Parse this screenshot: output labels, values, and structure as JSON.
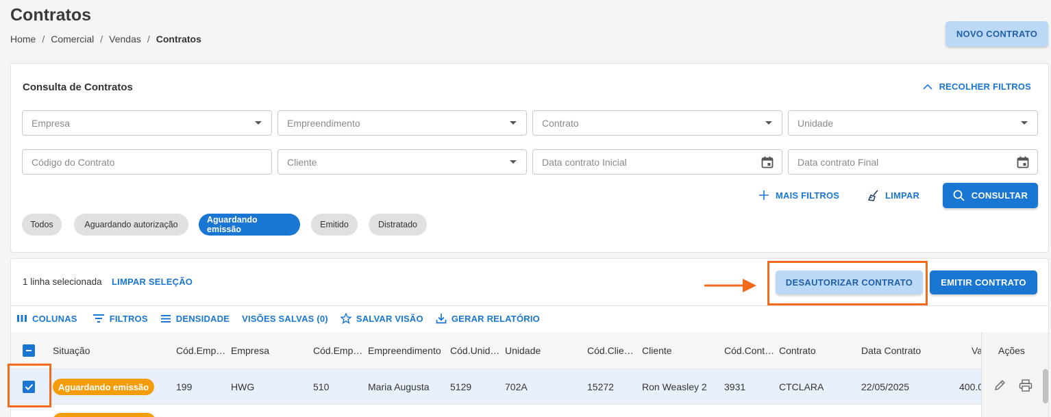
{
  "page": {
    "title": "Contratos"
  },
  "breadcrumb": {
    "items": [
      "Home",
      "Comercial",
      "Vendas"
    ],
    "current": "Contratos",
    "separator": "/"
  },
  "header": {
    "new_button": "NOVO CONTRATO"
  },
  "filters": {
    "title": "Consulta de Contratos",
    "collapse_label": "RECOLHER FILTROS",
    "fields": {
      "empresa": "Empresa",
      "empreendimento": "Empreendimento",
      "contrato": "Contrato",
      "unidade": "Unidade",
      "codigo": "Código do Contrato",
      "cliente": "Cliente",
      "data_inicial": "Data contrato Inicial",
      "data_final": "Data contrato Final"
    },
    "more_filters": "MAIS FILTROS",
    "clear": "LIMPAR",
    "search": "CONSULTAR",
    "chips": [
      "Todos",
      "Aguardando autorização",
      "Aguardando emissão",
      "Emitido",
      "Distratado"
    ],
    "active_chip": "Aguardando emissão"
  },
  "selection": {
    "text": "1 linha selecionada",
    "clear": "LIMPAR SELEÇÃO",
    "deauthorize": "DESAUTORIZAR CONTRATO",
    "emit": "EMITIR CONTRATO"
  },
  "toolbar": {
    "columns": "COLUNAS",
    "filters": "FILTROS",
    "density": "DENSIDADE",
    "saved_views": "VISÕES SALVAS (0)",
    "save_view": "SALVAR VISÃO",
    "report": "GERAR RELATÓRIO"
  },
  "table": {
    "headers": [
      "Situação",
      "Cód.Emp…",
      "Empresa",
      "Cód.Emp…",
      "Empreendimento",
      "Cód.Unid…",
      "Unidade",
      "Cód.Clie…",
      "Cliente",
      "Cód.Cont…",
      "Contrato",
      "Data Contrato",
      "Va",
      "Ações"
    ],
    "rows": [
      {
        "status": "Aguardando emissão",
        "cod_empresa": "199",
        "empresa": "HWG",
        "cod_empreend": "510",
        "empreendimento": "Maria Augusta",
        "cod_unidade": "5129",
        "unidade": "702A",
        "cod_cliente": "15272",
        "cliente": "Ron Weasley 2",
        "cod_contrato": "3931",
        "contrato": "CTCLARA",
        "data": "22/05/2025",
        "valor": "400.0",
        "selected": true
      }
    ]
  },
  "colors": {
    "primary": "#1976d2",
    "light_primary": "#bcd8f7",
    "status_orange": "#f59c0b",
    "highlight": "#f26a1b"
  }
}
